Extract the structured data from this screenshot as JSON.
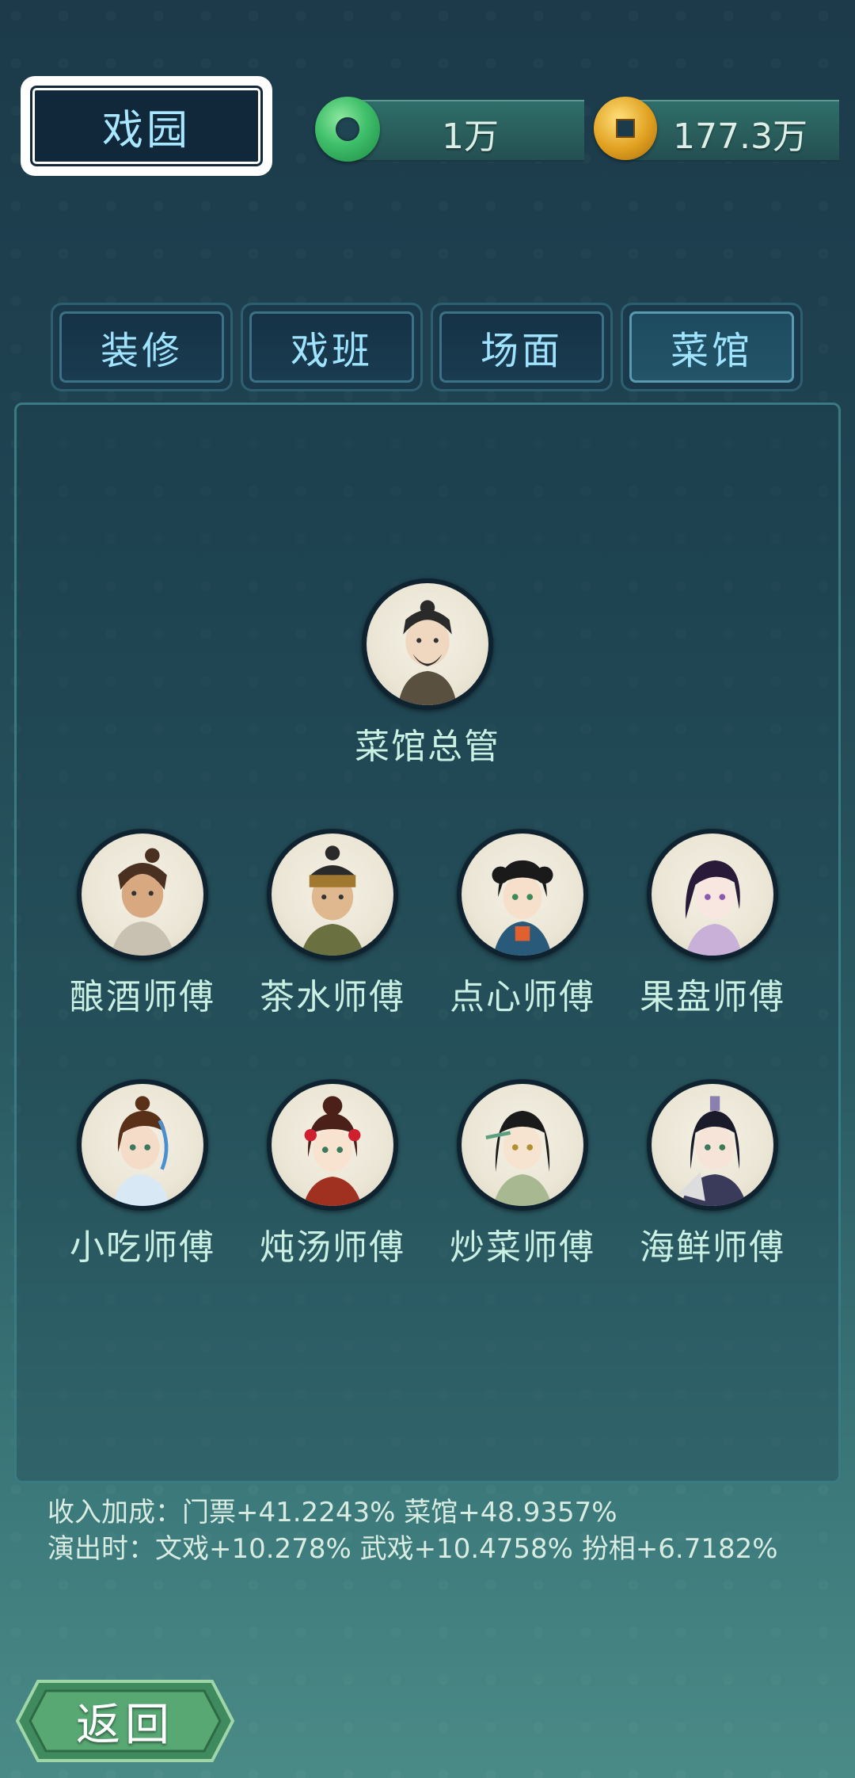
{
  "header": {
    "title": "戏园"
  },
  "currencies": {
    "jade": {
      "icon": "jade-ring-icon",
      "value": "1万"
    },
    "coin": {
      "icon": "copper-coin-icon",
      "value": "177.3万"
    }
  },
  "tabs": [
    {
      "label": "装修",
      "active": false
    },
    {
      "label": "戏班",
      "active": false
    },
    {
      "label": "场面",
      "active": false
    },
    {
      "label": "菜馆",
      "active": true
    }
  ],
  "manager": {
    "name": "菜馆总管"
  },
  "masters_row1": [
    {
      "name": "酿酒师傅"
    },
    {
      "name": "茶水师傅"
    },
    {
      "name": "点心师傅"
    },
    {
      "name": "果盘师傅"
    }
  ],
  "masters_row2": [
    {
      "name": "小吃师傅"
    },
    {
      "name": "炖汤师傅"
    },
    {
      "name": "炒菜师傅"
    },
    {
      "name": "海鲜师傅"
    }
  ],
  "stats": {
    "line1": "收入加成：门票+41.2243% 菜馆+48.9357%",
    "line2": "演出时：文戏+10.278% 武戏+10.4758% 扮相+6.7182%"
  },
  "back": {
    "label": "返回"
  },
  "colors": {
    "accent_text": "#9fe3ff",
    "name_text": "#c9f0e2",
    "back_button": "#5aa070"
  }
}
